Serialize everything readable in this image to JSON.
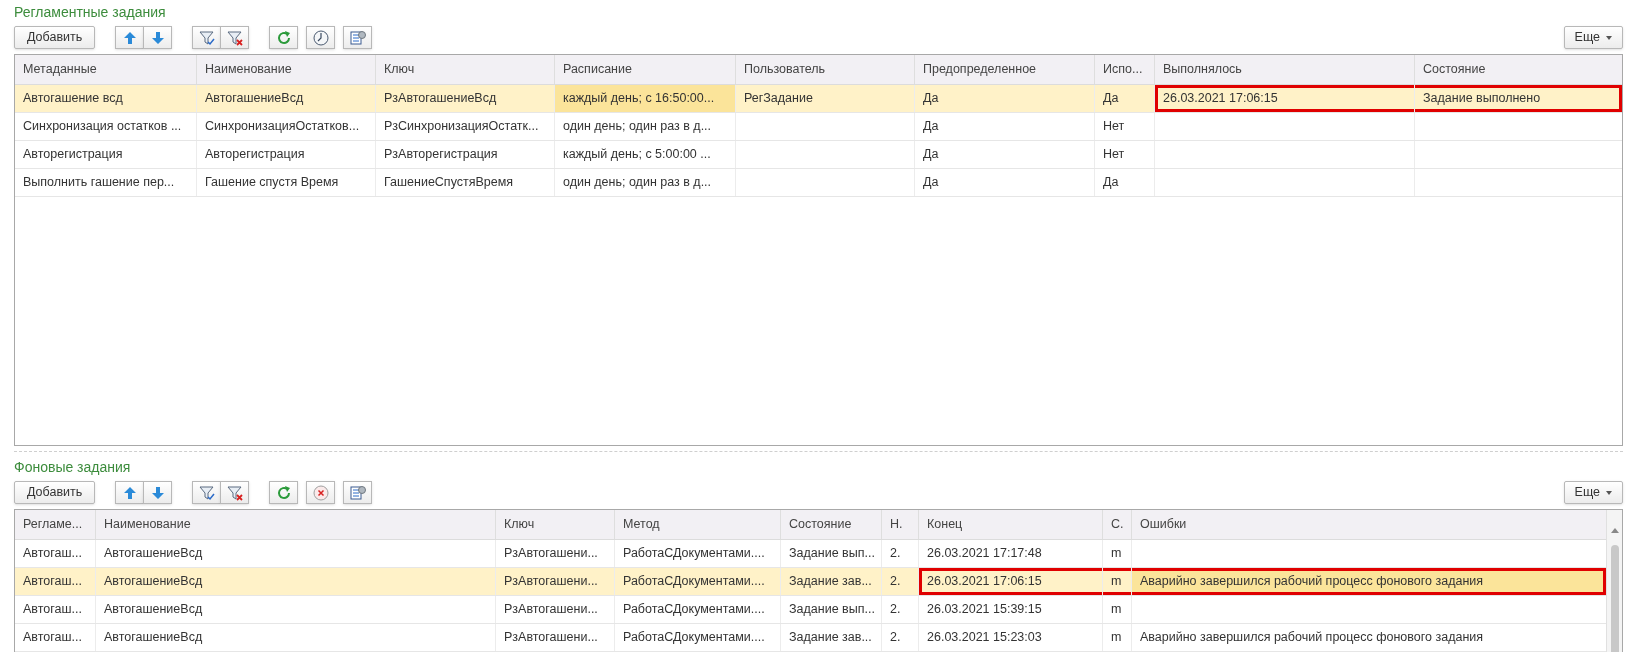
{
  "sections": [
    {
      "title": "Регламентные задания",
      "toolbar": {
        "add_label": "Добавить",
        "more_label": "Еще",
        "icons": [
          {
            "kind": "up"
          },
          {
            "kind": "down"
          },
          {
            "kind": "filter"
          },
          {
            "kind": "filter-clear"
          },
          {
            "kind": "refresh"
          },
          {
            "kind": "clock"
          },
          {
            "kind": "settings"
          }
        ]
      },
      "table": {
        "columns": [
          "Метаданные",
          "Наименование",
          "Ключ",
          "Расписание",
          "Пользователь",
          "Предопределенное",
          "Испо...",
          "Выполнялось",
          "Состояние"
        ],
        "rows": [
          {
            "selected": true,
            "cells": [
              {
                "text": "Автогашение всд",
                "current": false,
                "marked": false
              },
              {
                "text": "АвтогашениеВсд",
                "current": false,
                "marked": false
              },
              {
                "text": "РзАвтогашениеВсд",
                "current": false,
                "marked": false
              },
              {
                "text": "каждый день; с 16:50:00...",
                "current": true,
                "marked": false
              },
              {
                "text": "РегЗадание",
                "current": false,
                "marked": false
              },
              {
                "text": "Да",
                "current": false,
                "marked": false
              },
              {
                "text": "Да",
                "current": false,
                "marked": false
              },
              {
                "text": "26.03.2021 17:06:15",
                "current": false,
                "marked": true
              },
              {
                "text": "Задание выполнено",
                "current": false,
                "marked": true
              }
            ]
          },
          {
            "selected": false,
            "cells": [
              {
                "text": "Синхронизация остатков ...",
                "current": false,
                "marked": false
              },
              {
                "text": "СинхронизацияОстатков...",
                "current": false,
                "marked": false
              },
              {
                "text": "РзСинхронизацияОстатк...",
                "current": false,
                "marked": false
              },
              {
                "text": "один день; один раз в д...",
                "current": false,
                "marked": false
              },
              {
                "current": false,
                "marked": false
              },
              {
                "text": "Да",
                "current": false,
                "marked": false
              },
              {
                "text": "Нет",
                "current": false,
                "marked": false
              },
              {
                "current": false,
                "marked": false
              },
              {
                "current": false,
                "marked": false
              }
            ]
          },
          {
            "selected": false,
            "cells": [
              {
                "text": "Авторегистрация",
                "current": false,
                "marked": false
              },
              {
                "text": "Авторегистрация",
                "current": false,
                "marked": false
              },
              {
                "text": "РзАвторегистрация",
                "current": false,
                "marked": false
              },
              {
                "text": "каждый день; с 5:00:00 ...",
                "current": false,
                "marked": false
              },
              {
                "current": false,
                "marked": false
              },
              {
                "text": "Да",
                "current": false,
                "marked": false
              },
              {
                "text": "Нет",
                "current": false,
                "marked": false
              },
              {
                "current": false,
                "marked": false
              },
              {
                "current": false,
                "marked": false
              }
            ]
          },
          {
            "selected": false,
            "cells": [
              {
                "text": "Выполнить гашение пер...",
                "current": false,
                "marked": false
              },
              {
                "text": "Гашение спустя Время",
                "current": false,
                "marked": false
              },
              {
                "text": "ГашениеСпустяВремя",
                "current": false,
                "marked": false
              },
              {
                "text": "один день; один раз в д...",
                "current": false,
                "marked": false
              },
              {
                "current": false,
                "marked": false
              },
              {
                "text": "Да",
                "current": false,
                "marked": false
              },
              {
                "text": "Да",
                "current": false,
                "marked": false
              },
              {
                "current": false,
                "marked": false
              },
              {
                "current": false,
                "marked": false
              }
            ]
          }
        ]
      }
    },
    {
      "title": "Фоновые задания",
      "toolbar": {
        "add_label": "Добавить",
        "more_label": "Еще",
        "icons": [
          {
            "kind": "up"
          },
          {
            "kind": "down"
          },
          {
            "kind": "filter"
          },
          {
            "kind": "filter-clear"
          },
          {
            "kind": "refresh"
          },
          {
            "kind": "cancel"
          },
          {
            "kind": "settings"
          }
        ]
      },
      "table": {
        "columns": [
          "Регламе...",
          "Наименование",
          "Ключ",
          "Метод",
          "Состояние",
          "Н.",
          "Конец",
          "С.",
          "Ошибки"
        ],
        "rows": [
          {
            "selected": false,
            "cells": [
              {
                "text": "Автогаш...",
                "current": false,
                "marked": false
              },
              {
                "text": "АвтогашениеВсд",
                "current": false,
                "marked": false
              },
              {
                "text": "РзАвтогашени...",
                "current": false,
                "marked": false
              },
              {
                "text": "РаботаСДокументами....",
                "current": false,
                "marked": false
              },
              {
                "text": "Задание вып...",
                "current": false,
                "marked": false
              },
              {
                "text": "2.",
                "current": false,
                "marked": false
              },
              {
                "text": "26.03.2021 17:17:48",
                "current": false,
                "marked": false
              },
              {
                "text": "m",
                "current": false,
                "marked": false
              },
              {
                "current": false,
                "marked": false
              }
            ]
          },
          {
            "selected": true,
            "cells": [
              {
                "text": "Автогаш...",
                "current": false,
                "marked": false
              },
              {
                "text": "АвтогашениеВсд",
                "current": false,
                "marked": false
              },
              {
                "text": "РзАвтогашени...",
                "current": false,
                "marked": false
              },
              {
                "text": "РаботаСДокументами....",
                "current": false,
                "marked": false
              },
              {
                "text": "Задание зав...",
                "current": false,
                "marked": false
              },
              {
                "text": "2.",
                "current": false,
                "marked": false
              },
              {
                "text": "26.03.2021 17:06:15",
                "current": false,
                "marked": true
              },
              {
                "text": "m",
                "current": false,
                "marked": true
              },
              {
                "text": "Аварийно завершился рабочий процесс фонового задания",
                "current": true,
                "marked": true
              }
            ]
          },
          {
            "selected": false,
            "cells": [
              {
                "text": "Автогаш...",
                "current": false,
                "marked": false
              },
              {
                "text": "АвтогашениеВсд",
                "current": false,
                "marked": false
              },
              {
                "text": "РзАвтогашени...",
                "current": false,
                "marked": false
              },
              {
                "text": "РаботаСДокументами....",
                "current": false,
                "marked": false
              },
              {
                "text": "Задание вып...",
                "current": false,
                "marked": false
              },
              {
                "text": "2.",
                "current": false,
                "marked": false
              },
              {
                "text": "26.03.2021 15:39:15",
                "current": false,
                "marked": false
              },
              {
                "text": "m",
                "current": false,
                "marked": false
              },
              {
                "current": false,
                "marked": false
              }
            ]
          },
          {
            "selected": false,
            "cells": [
              {
                "text": "Автогаш...",
                "current": false,
                "marked": false
              },
              {
                "text": "АвтогашениеВсд",
                "current": false,
                "marked": false
              },
              {
                "text": "РзАвтогашени...",
                "current": false,
                "marked": false
              },
              {
                "text": "РаботаСДокументами....",
                "current": false,
                "marked": false
              },
              {
                "text": "Задание зав...",
                "current": false,
                "marked": false
              },
              {
                "text": "2.",
                "current": false,
                "marked": false
              },
              {
                "text": "26.03.2021 15:23:03",
                "current": false,
                "marked": false
              },
              {
                "text": "m",
                "current": false,
                "marked": false
              },
              {
                "text": "Аварийно завершился рабочий процесс фонового задания",
                "current": false,
                "marked": false
              }
            ]
          }
        ]
      }
    }
  ]
}
